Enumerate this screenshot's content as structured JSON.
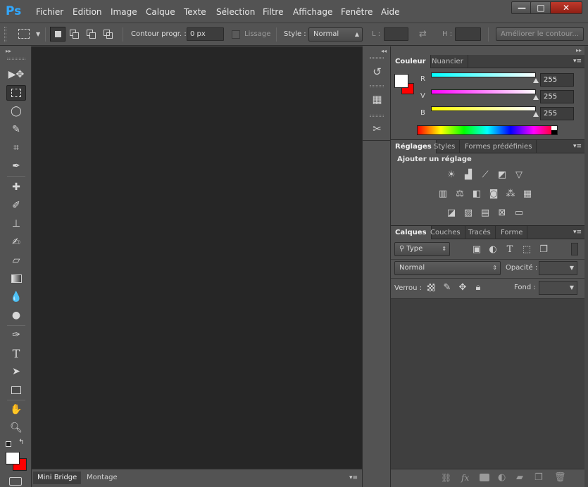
{
  "app": {
    "logo": "Ps"
  },
  "menu": [
    "Fichier",
    "Edition",
    "Image",
    "Calque",
    "Texte",
    "Sélection",
    "Filtre",
    "Affichage",
    "Fenêtre",
    "Aide"
  ],
  "window_controls": {
    "minimize": "—",
    "maximize": "□",
    "close": "✕"
  },
  "options": {
    "feather_label": "Contour progr. :",
    "feather_value": "0 px",
    "antialias_label": "Lissage",
    "style_label": "Style :",
    "style_value": "Normal",
    "width_label": "L :",
    "height_label": "H :",
    "refine_button": "Améliorer le contour..."
  },
  "toolbar": {
    "tools": [
      "move-tool",
      "marquee-tool",
      "lasso-tool",
      "quick-select-tool",
      "crop-tool",
      "eyedropper-tool",
      "healing-tool",
      "brush-tool",
      "stamp-tool",
      "history-brush-tool",
      "eraser-tool",
      "gradient-tool",
      "blur-tool",
      "dodge-tool",
      "pen-tool",
      "type-tool",
      "path-select-tool",
      "shape-tool",
      "hand-tool",
      "zoom-tool"
    ],
    "active_tool": "marquee-tool",
    "type_glyph": "T"
  },
  "bottom_tabs": [
    "Mini Bridge",
    "Montage"
  ],
  "color_panel": {
    "tabs": [
      "Couleur",
      "Nuancier"
    ],
    "channels": [
      {
        "label": "R",
        "value": "255",
        "color": "#00e5ff"
      },
      {
        "label": "V",
        "value": "255",
        "color": "#ff00ff"
      },
      {
        "label": "B",
        "value": "255",
        "color": "#ffff00"
      }
    ],
    "foreground": "#ffffff",
    "background": "#ff0000"
  },
  "adjustments_panel": {
    "tabs": [
      "Réglages",
      "Styles",
      "Formes prédéfinies"
    ],
    "heading": "Ajouter un réglage"
  },
  "layers_panel": {
    "tabs": [
      "Calques",
      "Couches",
      "Tracés",
      "Forme"
    ],
    "filter_label": "Type",
    "blend_mode": "Normal",
    "opacity_label": "Opacité :",
    "lock_label": "Verrou :",
    "fill_label": "Fond :",
    "fx_label": "fx"
  },
  "colors": {
    "accent": "#31a8ff",
    "bg_panel": "#535353",
    "canvas": "#262626"
  }
}
